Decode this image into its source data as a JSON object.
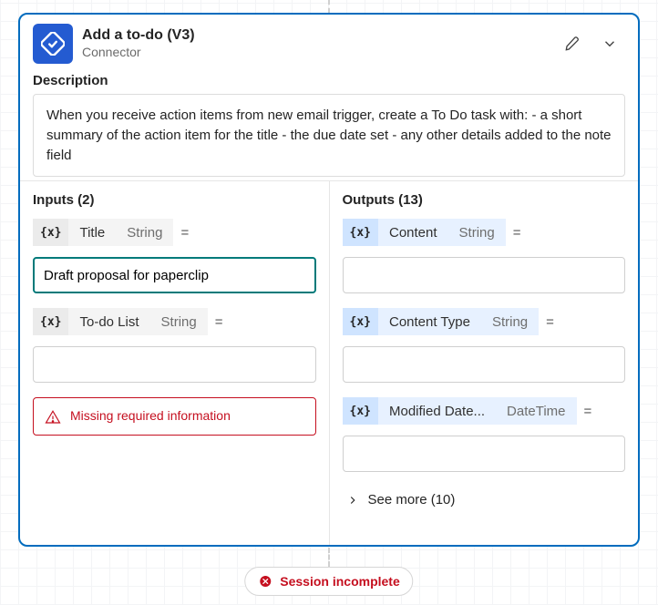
{
  "header": {
    "title": "Add a to-do (V3)",
    "subtitle": "Connector"
  },
  "description": {
    "label": "Description",
    "text": "When you receive action items from new email trigger, create a To Do task with: - a short summary of the action item for the title - the due date set - any other details added to the note field"
  },
  "inputs": {
    "label": "Inputs (2)",
    "items": [
      {
        "token": "{x}",
        "name": "Title",
        "type": "String",
        "value": "Draft proposal for paperclip",
        "active": true
      },
      {
        "token": "{x}",
        "name": "To-do List",
        "type": "String",
        "value": "",
        "active": false
      }
    ],
    "error": "Missing required information"
  },
  "outputs": {
    "label": "Outputs (13)",
    "items": [
      {
        "token": "{x}",
        "name": "Content",
        "type": "String"
      },
      {
        "token": "{x}",
        "name": "Content Type",
        "type": "String"
      },
      {
        "token": "{x}",
        "name": "Modified Date...",
        "type": "DateTime"
      }
    ],
    "see_more": "See more (10)"
  },
  "status_badge": "Session incomplete"
}
